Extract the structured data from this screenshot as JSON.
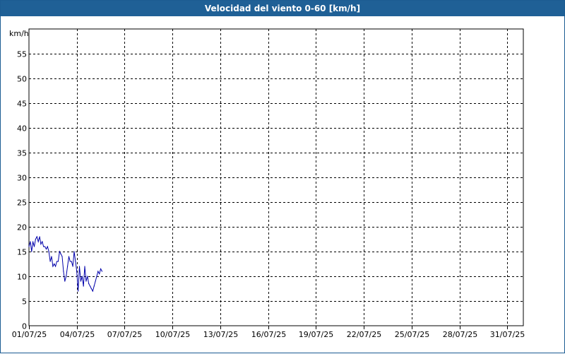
{
  "window": {
    "title": "Velocidad del viento 0-60 [km/h]"
  },
  "colors": {
    "titlebar": "#1f6096",
    "series": "#0000aa",
    "grid": "#000000"
  },
  "chart_data": {
    "type": "line",
    "title": "Velocidad del viento 0-60 [km/h]",
    "ylabel": "km/h",
    "xlabel": "",
    "ylim": [
      0,
      60
    ],
    "yticks": [
      0,
      5,
      10,
      15,
      20,
      25,
      30,
      35,
      40,
      45,
      50,
      55
    ],
    "xticks": [
      "01/07/25",
      "04/07/25",
      "07/07/25",
      "10/07/25",
      "13/07/25",
      "16/07/25",
      "19/07/25",
      "22/07/25",
      "25/07/25",
      "28/07/25",
      "31/07/25"
    ],
    "xlim": [
      "01/07/25 00:00",
      "31/07/25 24:00"
    ],
    "grid": true,
    "series": [
      {
        "x": [
          "01/07/25 00:00",
          "01/07/25 02:00",
          "01/07/25 04:00",
          "01/07/25 06:00",
          "01/07/25 08:00",
          "01/07/25 10:00",
          "01/07/25 12:00",
          "01/07/25 14:00",
          "01/07/25 16:00",
          "01/07/25 18:00",
          "01/07/25 20:00",
          "01/07/25 22:00",
          "02/07/25 00:00",
          "02/07/25 02:00",
          "02/07/25 04:00",
          "02/07/25 06:00",
          "02/07/25 08:00",
          "02/07/25 10:00",
          "02/07/25 12:00",
          "02/07/25 14:00",
          "02/07/25 16:00",
          "02/07/25 18:00",
          "02/07/25 20:00",
          "02/07/25 22:00",
          "03/07/25 00:00",
          "03/07/25 02:00",
          "03/07/25 04:00",
          "03/07/25 06:00",
          "03/07/25 08:00",
          "03/07/25 10:00",
          "03/07/25 12:00",
          "03/07/25 14:00",
          "03/07/25 16:00",
          "03/07/25 18:00",
          "03/07/25 20:00",
          "03/07/25 22:00",
          "04/07/25 00:00",
          "04/07/25 02:00",
          "04/07/25 04:00",
          "04/07/25 06:00",
          "04/07/25 08:00",
          "04/07/25 10:00",
          "04/07/25 12:00",
          "04/07/25 14:00",
          "04/07/25 16:00",
          "04/07/25 18:00",
          "04/07/25 20:00",
          "04/07/25 22:00",
          "05/07/25 00:00",
          "05/07/25 02:00",
          "05/07/25 04:00",
          "05/07/25 06:00",
          "05/07/25 08:00",
          "05/07/25 10:00",
          "05/07/25 12:00",
          "05/07/25 14:00"
        ],
        "values": [
          16,
          17,
          15,
          17,
          16,
          17.5,
          18,
          17,
          18,
          16.5,
          17,
          16,
          16,
          15.5,
          16,
          15,
          13,
          14,
          12,
          12.5,
          12,
          13,
          13,
          15,
          14.5,
          14,
          11,
          9,
          10,
          12,
          14,
          13,
          13,
          12,
          15,
          13,
          11,
          7,
          12,
          9,
          10,
          8,
          12,
          9,
          10,
          8.5,
          8,
          7.5,
          7,
          8,
          9,
          10,
          11,
          10.5,
          11.5,
          11
        ]
      }
    ]
  }
}
